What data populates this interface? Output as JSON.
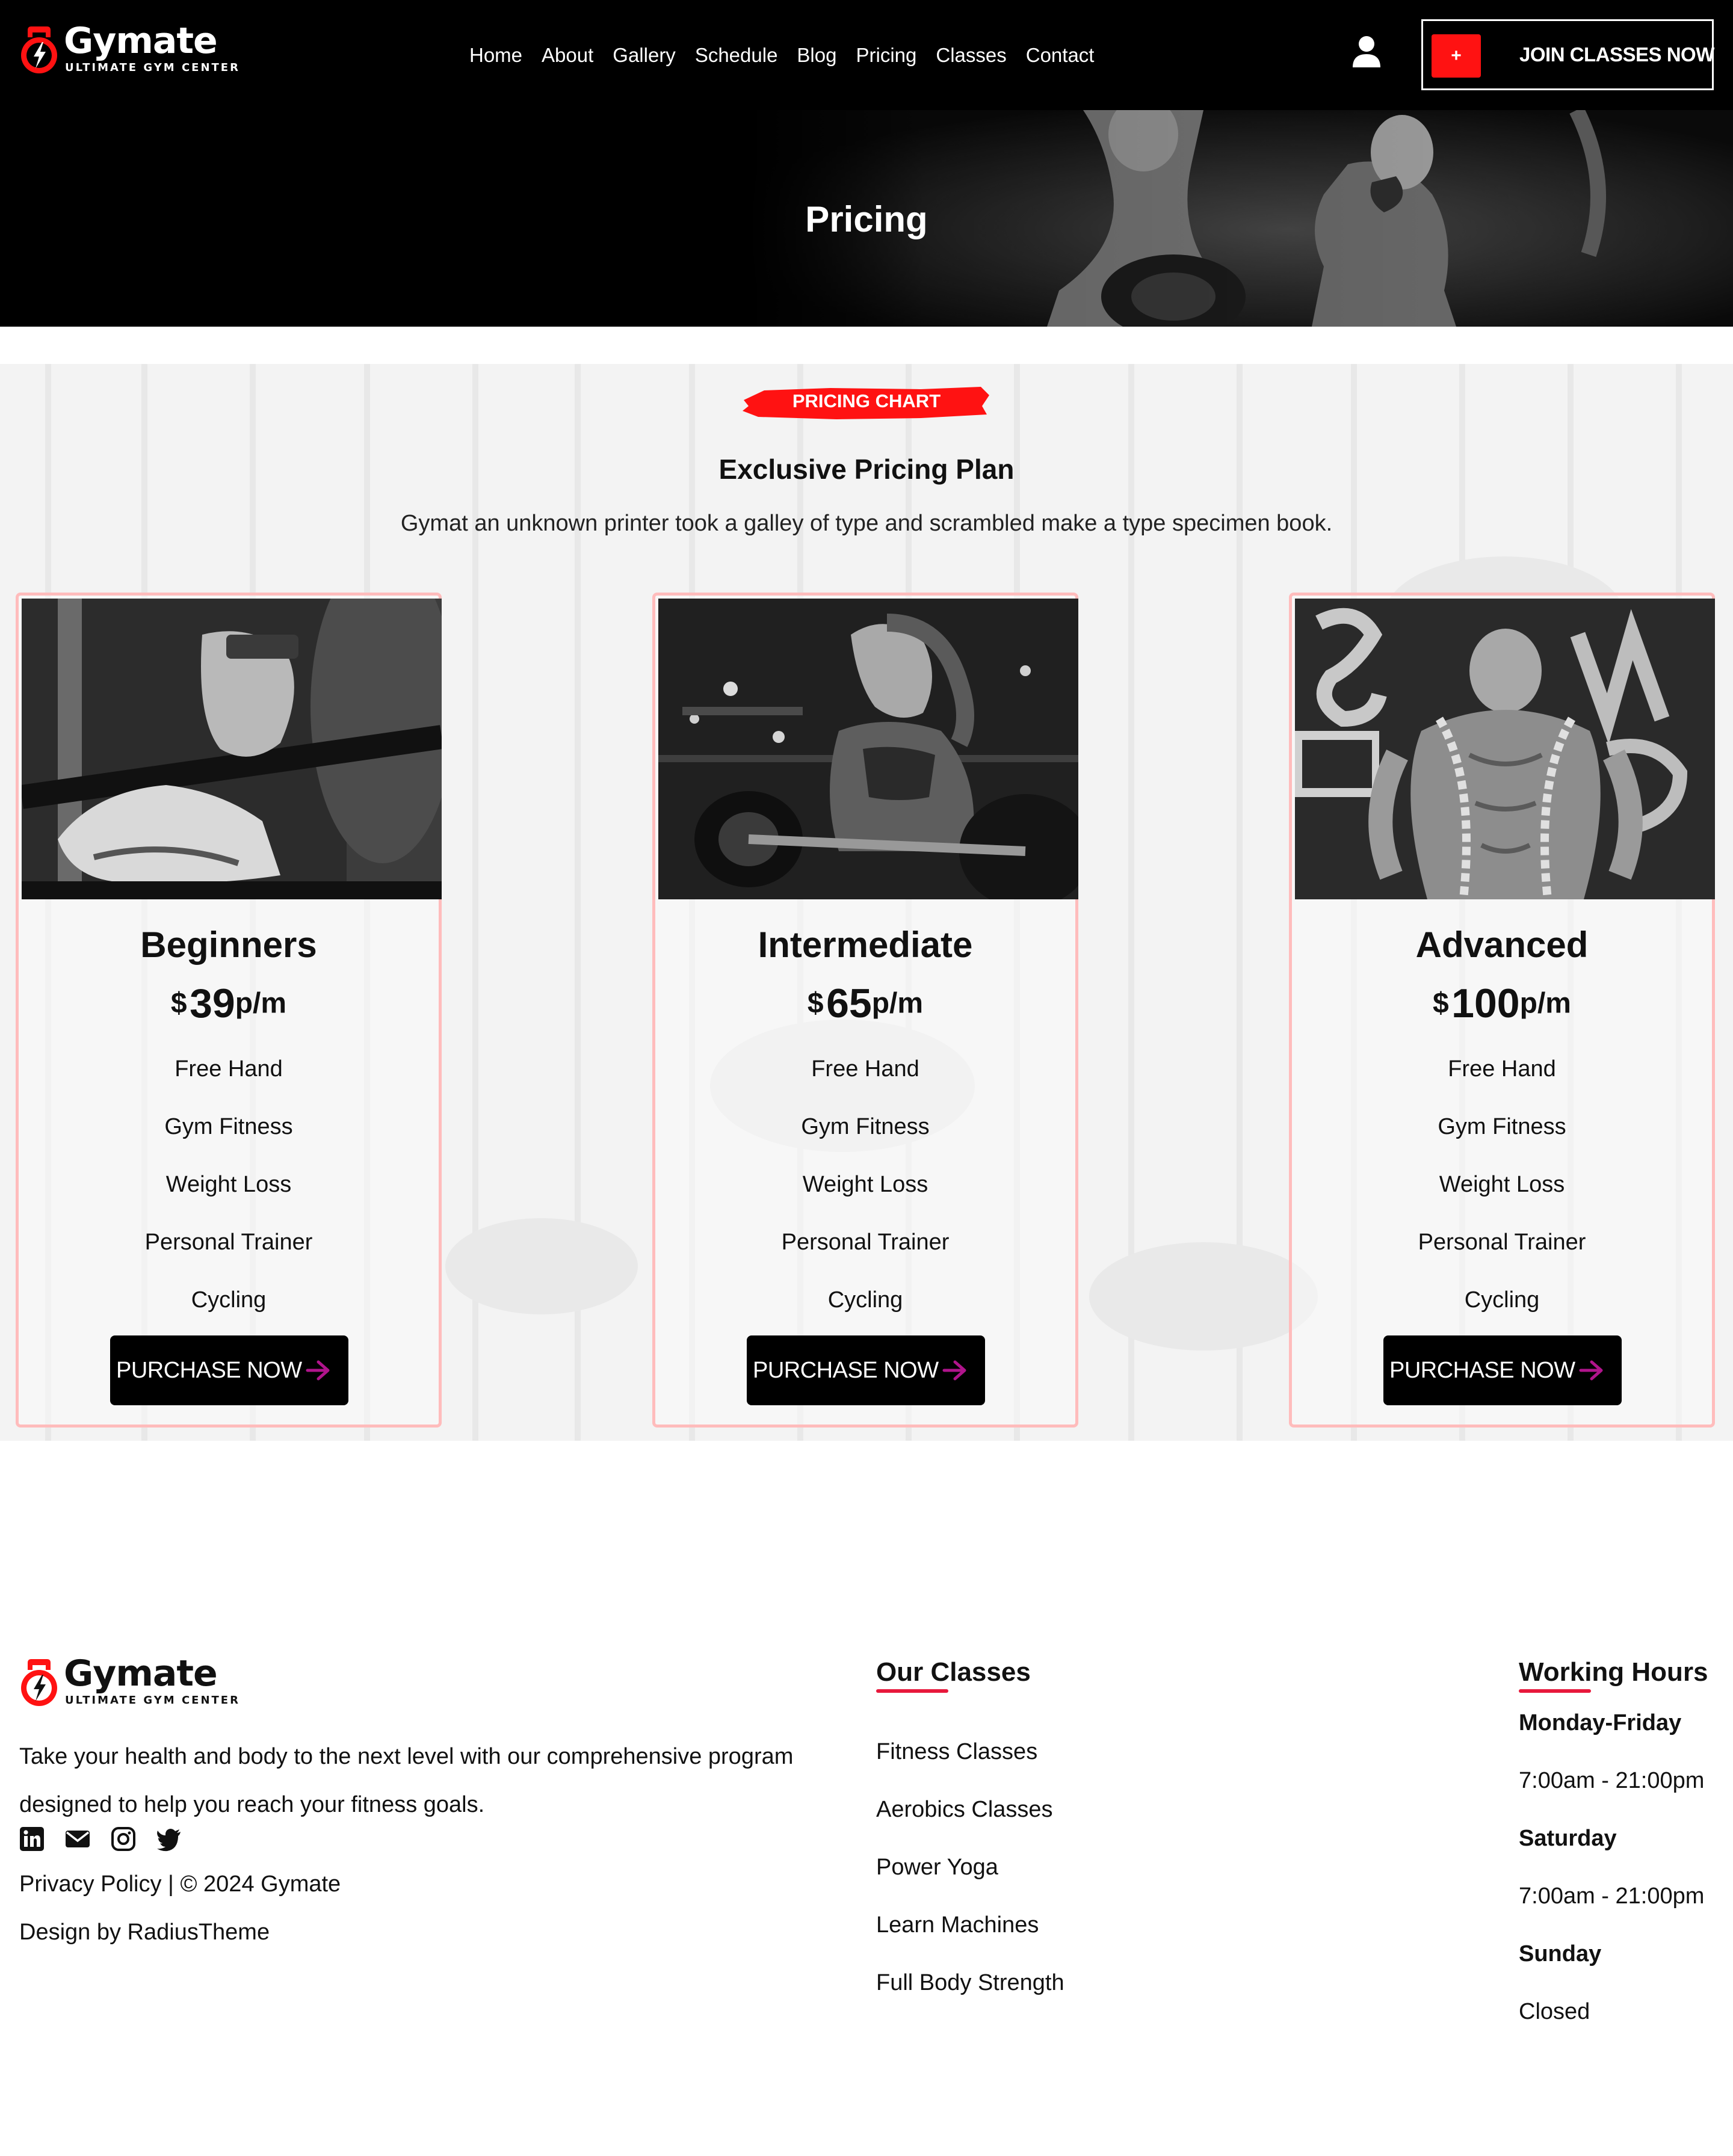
{
  "brand": {
    "name": "Gymate",
    "tagline": "ULTIMATE GYM CENTER",
    "accent_color": "#ff1212",
    "logo_icon": "kettlebell-bolt-icon"
  },
  "header": {
    "nav": [
      "Home",
      "About",
      "Gallery",
      "Schedule",
      "Blog",
      "Pricing",
      "Classes",
      "Contact"
    ],
    "user_icon": "user-icon",
    "cta_icon_text": "+",
    "cta_label": "JOIN CLASSES NOW"
  },
  "hero": {
    "title": "Pricing"
  },
  "pricing": {
    "chip": "PRICING CHART",
    "title": "Exclusive Pricing Plan",
    "description": "Gymat an unknown printer took a galley of type and scrambled make a type specimen book.",
    "plans": [
      {
        "name": "Beginners",
        "currency": "$",
        "amount": "39",
        "period": "p/m",
        "features": [
          "Free Hand",
          "Gym Fitness",
          "Weight Loss",
          "Personal Trainer",
          "Cycling"
        ],
        "button": "PURCHASE NOW"
      },
      {
        "name": "Intermediate",
        "currency": "$",
        "amount": "65",
        "period": "p/m",
        "features": [
          "Free Hand",
          "Gym Fitness",
          "Weight Loss",
          "Personal Trainer",
          "Cycling"
        ],
        "button": "PURCHASE NOW"
      },
      {
        "name": "Advanced",
        "currency": "$",
        "amount": "100",
        "period": "p/m",
        "features": [
          "Free Hand",
          "Gym Fitness",
          "Weight Loss",
          "Personal Trainer",
          "Cycling"
        ],
        "button": "PURCHASE NOW"
      }
    ],
    "button_arrow_color": "#b0148c",
    "card_border_color": "#ffbcbc"
  },
  "footer": {
    "about": "Take your health and body to the next level with our comprehensive program designed to help you reach your fitness goals.",
    "socials": [
      "linkedin-icon",
      "envelope-icon",
      "instagram-icon",
      "twitter-icon"
    ],
    "copyright": "Privacy Policy | © 2024 Gymate",
    "credit": "Design by RadiusTheme",
    "classes_title": "Our Classes",
    "classes": [
      "Fitness Classes",
      "Aerobics Classes",
      "Power Yoga",
      "Learn Machines",
      "Full Body Strength"
    ],
    "hours_title": "Working Hours",
    "hours": [
      {
        "day": "Monday-Friday",
        "time": "7:00am - 21:00pm"
      },
      {
        "day": "Saturday",
        "time": "7:00am - 21:00pm"
      },
      {
        "day": "Sunday",
        "time": "Closed"
      }
    ],
    "underline_color": "#e8193c"
  }
}
